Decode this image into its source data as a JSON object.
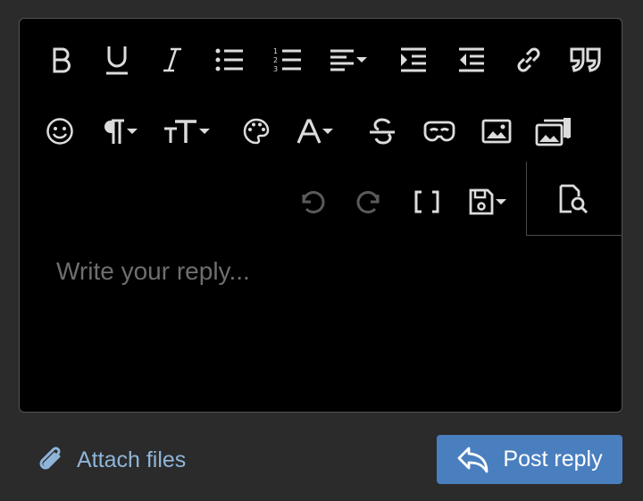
{
  "editor": {
    "placeholder": "Write your reply...",
    "toolbar_row1": [
      "bold-icon",
      "underline-icon",
      "italic-icon",
      "bullet-list-icon",
      "numbered-list-icon",
      "align-icon",
      "indent-icon",
      "outdent-icon",
      "link-icon",
      "quote-icon"
    ],
    "toolbar_row2": [
      "emoji-icon",
      "paragraph-format-icon",
      "font-size-icon",
      "palette-icon",
      "text-color-icon",
      "strikethrough-icon",
      "spoiler-icon",
      "image-icon",
      "media-gallery-icon"
    ],
    "toolbar_row3": [
      "undo-icon",
      "redo-icon",
      "bbcode-toggle-icon",
      "drafts-icon",
      "preview-icon"
    ]
  },
  "footer": {
    "attach_label": "Attach files",
    "post_label": "Post reply"
  },
  "colors": {
    "background": "#2b2b2b",
    "editor_bg": "#000000",
    "icon": "#dcdcdc",
    "icon_disabled": "#5a5a5a",
    "placeholder": "#6e6e6e",
    "link": "#8fb5d9",
    "primary_button": "#4a7fbf"
  }
}
